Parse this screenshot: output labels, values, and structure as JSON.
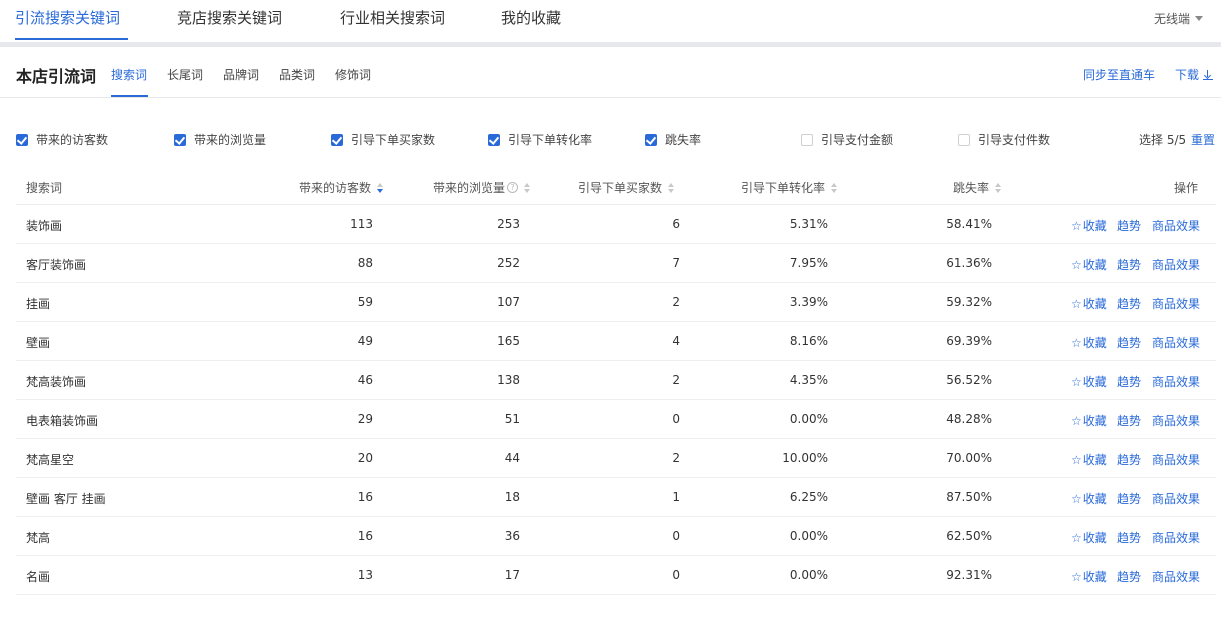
{
  "top_tabs": [
    "引流搜索关键词",
    "竞店搜索关键词",
    "行业相关搜索词",
    "我的收藏"
  ],
  "device": "无线端",
  "section_title": "本店引流词",
  "sub_tabs": [
    "搜索词",
    "长尾词",
    "品牌词",
    "品类词",
    "修饰词"
  ],
  "sync_link": "同步至直通车",
  "download_link": "下载",
  "filters": [
    {
      "label": "带来的访客数",
      "checked": true
    },
    {
      "label": "带来的浏览量",
      "checked": true
    },
    {
      "label": "引导下单买家数",
      "checked": true
    },
    {
      "label": "引导下单转化率",
      "checked": true
    },
    {
      "label": "跳失率",
      "checked": true
    },
    {
      "label": "引导支付金额",
      "checked": false
    },
    {
      "label": "引导支付件数",
      "checked": false
    }
  ],
  "select_count": "选择 5/5",
  "reset": "重置",
  "columns": [
    "搜索词",
    "带来的访客数",
    "带来的浏览量",
    "引导下单买家数",
    "引导下单转化率",
    "跳失率",
    "操作"
  ],
  "actions": {
    "favorite": "收藏",
    "trend": "趋势",
    "effect": "商品效果"
  },
  "rows": [
    [
      "装饰画",
      "113",
      "253",
      "6",
      "5.31%",
      "58.41%"
    ],
    [
      "客厅装饰画",
      "88",
      "252",
      "7",
      "7.95%",
      "61.36%"
    ],
    [
      "挂画",
      "59",
      "107",
      "2",
      "3.39%",
      "59.32%"
    ],
    [
      "壁画",
      "49",
      "165",
      "4",
      "8.16%",
      "69.39%"
    ],
    [
      "梵高装饰画",
      "46",
      "138",
      "2",
      "4.35%",
      "56.52%"
    ],
    [
      "电表箱装饰画",
      "29",
      "51",
      "0",
      "0.00%",
      "48.28%"
    ],
    [
      "梵高星空",
      "20",
      "44",
      "2",
      "10.00%",
      "70.00%"
    ],
    [
      "壁画 客厅 挂画",
      "16",
      "18",
      "1",
      "6.25%",
      "87.50%"
    ],
    [
      "梵高",
      "16",
      "36",
      "0",
      "0.00%",
      "62.50%"
    ],
    [
      "名画",
      "13",
      "17",
      "0",
      "0.00%",
      "92.31%"
    ]
  ],
  "colors": {
    "accent": "#2a6ad8"
  }
}
